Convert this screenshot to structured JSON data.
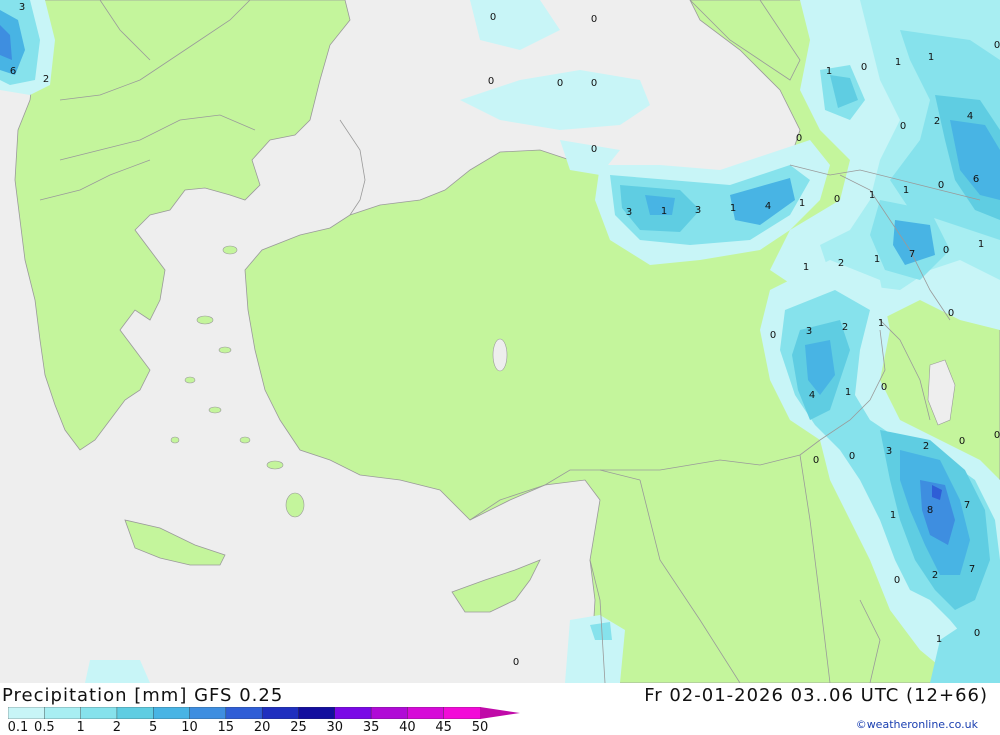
{
  "title": "Precipitation [mm] GFS 0.25",
  "datetime": "Fr 02-01-2026 03..06 UTC (12+66)",
  "credit": "©weatheronline.co.uk",
  "legend": {
    "ticks": [
      "0.1",
      "0.5",
      "1",
      "2",
      "5",
      "10",
      "15",
      "20",
      "25",
      "30",
      "35",
      "40",
      "45",
      "50"
    ],
    "colors": [
      "#c8f5f7",
      "#a8eef2",
      "#86e2ec",
      "#5fcde2",
      "#48b4e4",
      "#3e8ee0",
      "#2f5ed6",
      "#1f2fbf",
      "#130e9e",
      "#7a08e6",
      "#b00ad6",
      "#d60ad8",
      "#f20ad8",
      "#c00aa8"
    ]
  },
  "colors": {
    "sea": "#eeeeee",
    "land": "#c4f59c",
    "border": "#9a9a9a"
  },
  "value_labels": [
    "3",
    "6",
    "2",
    "0",
    "0",
    "0",
    "0",
    "0",
    "0",
    "0",
    "1",
    "0",
    "1",
    "1",
    "0",
    "0",
    "2",
    "4",
    "6",
    "3",
    "1",
    "3",
    "1",
    "4",
    "1",
    "0",
    "1",
    "1",
    "0",
    "7",
    "0",
    "1",
    "1",
    "2",
    "1",
    "0",
    "3",
    "2",
    "1",
    "0",
    "4",
    "1",
    "0",
    "3",
    "2",
    "0",
    "0",
    "0",
    "0",
    "1",
    "8",
    "7",
    "0",
    "2",
    "7",
    "1",
    "0",
    "0"
  ]
}
